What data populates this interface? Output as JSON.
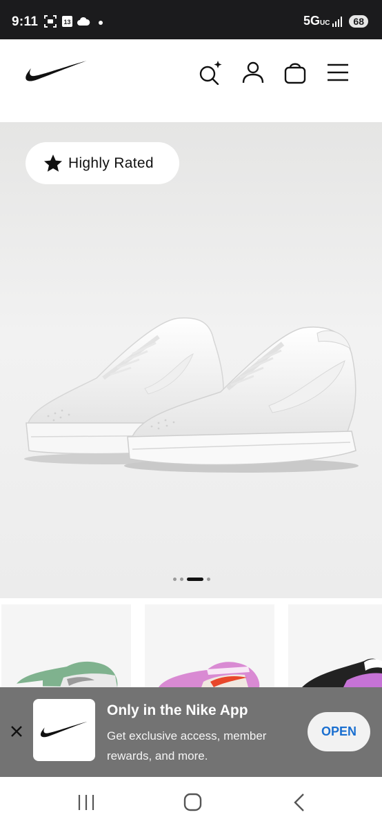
{
  "status_bar": {
    "time": "9:11",
    "calendar_day": "13",
    "network": "5G",
    "network_sub": "UC",
    "battery": "68",
    "icons": [
      "screenshot-icon",
      "calendar-icon",
      "cloud-icon",
      "dot-icon",
      "signal-icon",
      "battery-icon"
    ]
  },
  "header": {
    "icons": [
      "nike-logo",
      "ai-search-icon",
      "account-icon",
      "bag-icon",
      "menu-icon"
    ]
  },
  "hero": {
    "badge_label": "Highly Rated",
    "badge_icon": "star-icon",
    "carousel": {
      "count": 4,
      "active_index": 2
    }
  },
  "thumbnails": [
    {
      "accent": "#7fb28e"
    },
    {
      "accent": "#d98ad3"
    },
    {
      "accent": "#c673d6"
    }
  ],
  "app_banner": {
    "title": "Only in the Nike App",
    "description": "Get exclusive access, member rewards, and more.",
    "open_label": "OPEN",
    "accent_color": "#1a6fd0"
  },
  "nav_bar": {
    "icons": [
      "recents-icon",
      "home-icon",
      "back-icon"
    ]
  }
}
